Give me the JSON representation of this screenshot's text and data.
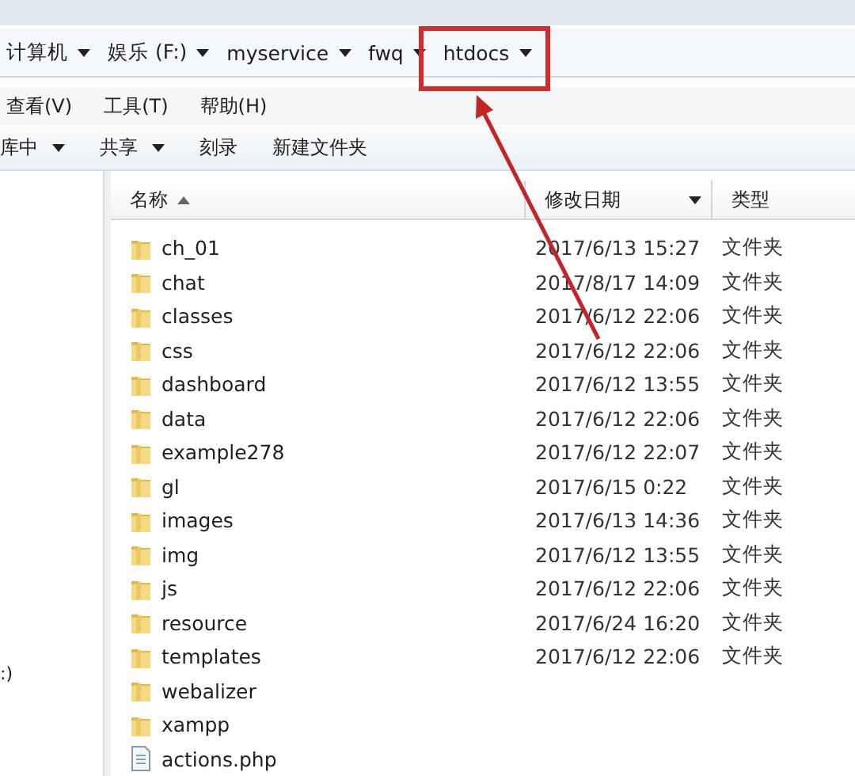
{
  "address_bar": {
    "segments": [
      {
        "label": "计算机",
        "dropdown": true
      },
      {
        "label": "娱乐 (F:)",
        "dropdown": true
      },
      {
        "label": "myservice",
        "dropdown": true
      },
      {
        "label": "fwq",
        "dropdown": true
      },
      {
        "label": "htdocs",
        "dropdown": true
      }
    ]
  },
  "menu_bar": [
    "查看(V)",
    "工具(T)",
    "帮助(H)"
  ],
  "toolbar": [
    {
      "label": "库中",
      "dropdown": true
    },
    {
      "label": "共享",
      "dropdown": true
    },
    {
      "label": "刻录",
      "dropdown": false
    },
    {
      "label": "新建文件夹",
      "dropdown": false
    }
  ],
  "navigation_pane": {
    "items": [
      ":)"
    ]
  },
  "columns": [
    {
      "label": "名称",
      "sorted": true,
      "dropdown": false
    },
    {
      "label": "修改日期",
      "sorted": false,
      "dropdown": true
    },
    {
      "label": "类型",
      "sorted": false,
      "dropdown": false
    }
  ],
  "files": [
    {
      "name": "ch_01",
      "date": "2017/6/13 15:27",
      "type": "文件夹",
      "kind": "folder"
    },
    {
      "name": "chat",
      "date": "2017/8/17 14:09",
      "type": "文件夹",
      "kind": "folder"
    },
    {
      "name": "classes",
      "date": "2017/6/12 22:06",
      "type": "文件夹",
      "kind": "folder"
    },
    {
      "name": "css",
      "date": "2017/6/12 22:06",
      "type": "文件夹",
      "kind": "folder"
    },
    {
      "name": "dashboard",
      "date": "2017/6/12 13:55",
      "type": "文件夹",
      "kind": "folder"
    },
    {
      "name": "data",
      "date": "2017/6/12 22:06",
      "type": "文件夹",
      "kind": "folder"
    },
    {
      "name": "example278",
      "date": "2017/6/12 22:07",
      "type": "文件夹",
      "kind": "folder"
    },
    {
      "name": "gl",
      "date": "2017/6/15 0:22",
      "type": "文件夹",
      "kind": "folder"
    },
    {
      "name": "images",
      "date": "2017/6/13 14:36",
      "type": "文件夹",
      "kind": "folder"
    },
    {
      "name": "img",
      "date": "2017/6/12 13:55",
      "type": "文件夹",
      "kind": "folder"
    },
    {
      "name": "js",
      "date": "2017/6/12 22:06",
      "type": "文件夹",
      "kind": "folder"
    },
    {
      "name": "resource",
      "date": "2017/6/24 16:20",
      "type": "文件夹",
      "kind": "folder"
    },
    {
      "name": "templates",
      "date": "2017/6/12 22:06",
      "type": "文件夹",
      "kind": "folder"
    },
    {
      "name": "webalizer",
      "kind": "folder"
    },
    {
      "name": "xampp",
      "kind": "folder"
    },
    {
      "name": "actions.php",
      "kind": "file"
    }
  ]
}
